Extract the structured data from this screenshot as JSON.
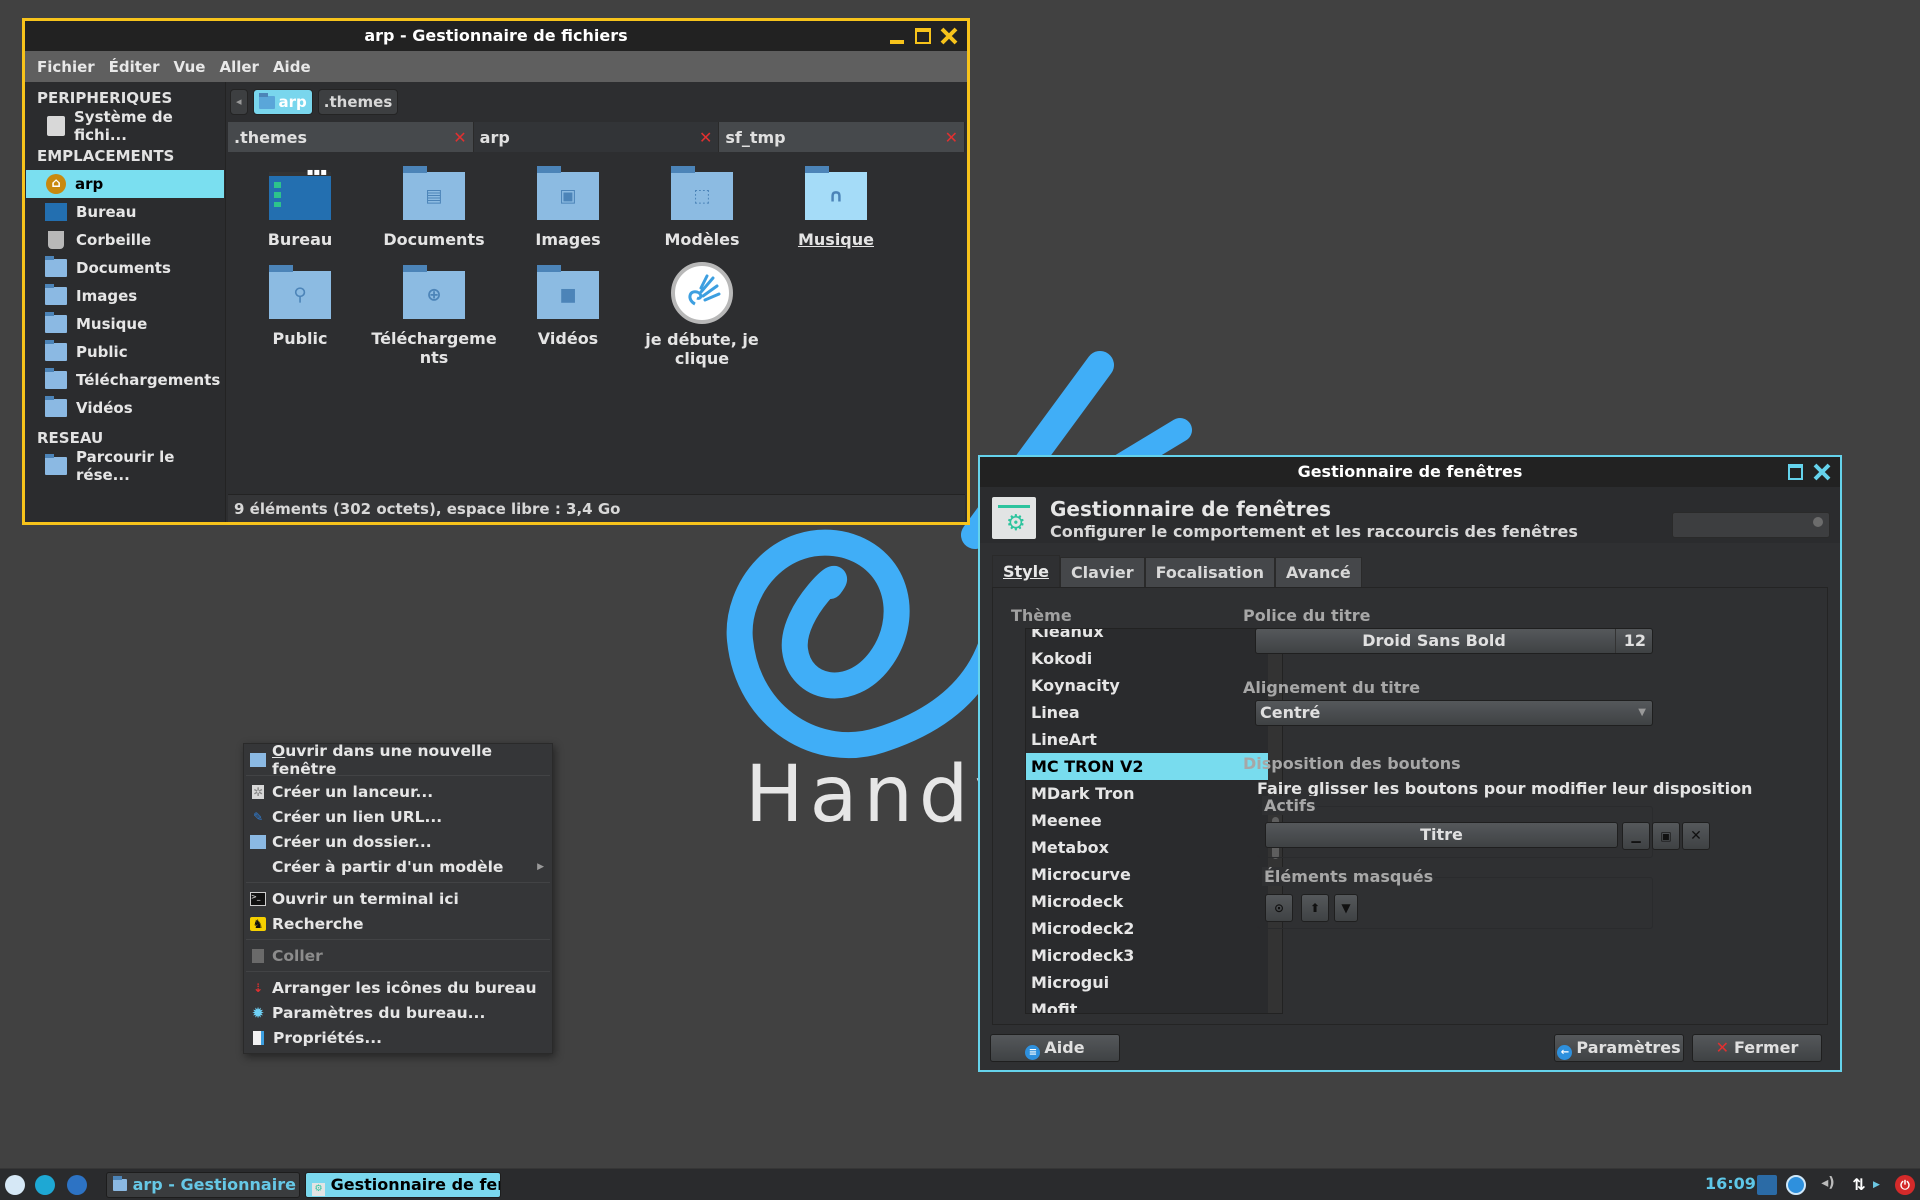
{
  "desktop": {
    "wallpaper_text": "Handy",
    "accent_color": "#40aef7"
  },
  "file_manager": {
    "title": "arp - Gestionnaire de fichiers",
    "border_color": "#f7c31b",
    "menu": [
      "Fichier",
      "Éditer",
      "Vue",
      "Aller",
      "Aide"
    ],
    "sidebar": {
      "sections": [
        {
          "heading": "PERIPHERIQUES",
          "items": [
            {
              "label": "Système de fichi...",
              "icon": "drive-icon"
            }
          ]
        },
        {
          "heading": "EMPLACEMENTS",
          "items": [
            {
              "label": "arp",
              "icon": "home-icon",
              "active": true
            },
            {
              "label": "Bureau",
              "icon": "desktop-folder-icon"
            },
            {
              "label": "Corbeille",
              "icon": "trash-icon"
            },
            {
              "label": "Documents",
              "icon": "documents-folder-icon"
            },
            {
              "label": "Images",
              "icon": "images-folder-icon"
            },
            {
              "label": "Musique",
              "icon": "music-folder-icon"
            },
            {
              "label": "Public",
              "icon": "public-folder-icon"
            },
            {
              "label": "Téléchargements",
              "icon": "downloads-folder-icon"
            },
            {
              "label": "Vidéos",
              "icon": "videos-folder-icon"
            }
          ]
        },
        {
          "heading": "RESEAU",
          "items": [
            {
              "label": "Parcourir le rése...",
              "icon": "network-folder-icon"
            }
          ]
        }
      ]
    },
    "pathbar": {
      "back": "◂",
      "crumbs": [
        "arp",
        ".themes"
      ],
      "active_crumb": "arp"
    },
    "tabs": [
      {
        "label": ".themes",
        "active": false
      },
      {
        "label": "arp",
        "active": true
      },
      {
        "label": "sf_tmp",
        "active": false
      }
    ],
    "tab_close_glyph": "✕",
    "items": [
      {
        "label": "Bureau",
        "icon": "desktop-folder-icon"
      },
      {
        "label": "Documents",
        "icon": "documents-folder-icon"
      },
      {
        "label": "Images",
        "icon": "images-folder-icon"
      },
      {
        "label": "Modèles",
        "icon": "templates-folder-icon"
      },
      {
        "label": "Musique",
        "icon": "music-folder-icon",
        "hovered": true
      },
      {
        "label": "Public",
        "icon": "public-folder-icon"
      },
      {
        "label": "Téléchargements",
        "icon": "downloads-folder-icon"
      },
      {
        "label": "Vidéos",
        "icon": "videos-folder-icon"
      },
      {
        "label": "je débute, je clique",
        "icon": "handy-launcher-icon"
      }
    ],
    "status": "9 éléments (302 octets), espace libre : 3,4 Go"
  },
  "context_menu": {
    "items": [
      {
        "label": "Ouvrir dans une nouvelle fenêtre",
        "icon": "folder-icon"
      },
      {
        "separator": true
      },
      {
        "label": "Créer un lanceur...",
        "icon": "launcher-icon"
      },
      {
        "label": "Créer un lien URL...",
        "icon": "url-link-icon"
      },
      {
        "label": "Créer un dossier...",
        "icon": "folder-icon"
      },
      {
        "label": "Créer à partir d'un modèle",
        "icon": "",
        "submenu": true
      },
      {
        "separator": true
      },
      {
        "label": "Ouvrir un terminal ici",
        "icon": "terminal-icon"
      },
      {
        "label": "Recherche",
        "icon": "search-catfish-icon"
      },
      {
        "separator": true
      },
      {
        "label": "Coller",
        "icon": "paste-icon",
        "disabled": true
      },
      {
        "separator": true
      },
      {
        "label": "Arranger les icônes du bureau",
        "icon": "arrange-icon"
      },
      {
        "label": "Paramètres du bureau...",
        "icon": "desktop-settings-icon"
      },
      {
        "label": "Propriétés...",
        "icon": "properties-icon"
      }
    ]
  },
  "wm_dialog": {
    "title": "Gestionnaire de fenêtres",
    "border_color": "#65d3ec",
    "header_title": "Gestionnaire de fenêtres",
    "header_subtitle": "Configurer le comportement et les raccourcis des fenêtres",
    "search_placeholder": "",
    "tabs": [
      {
        "label": "Style",
        "active": true
      },
      {
        "label": "Clavier",
        "active": false
      },
      {
        "label": "Focalisation",
        "active": false
      },
      {
        "label": "Avancé",
        "active": false
      }
    ],
    "theme_label": "Thème",
    "themes": [
      "Kleanux",
      "Kokodi",
      "Koynacity",
      "Linea",
      "LineArt",
      "MC TRON V2",
      "MDark Tron",
      "Meenee",
      "Metabox",
      "Microcurve",
      "Microdeck",
      "Microdeck2",
      "Microdeck3",
      "Microgui",
      "Mofit"
    ],
    "selected_theme": "MC TRON V2",
    "title_font_label": "Police du titre",
    "title_font_name": "Droid Sans Bold",
    "title_font_size": "12",
    "title_align_label": "Alignement du titre",
    "title_align_value": "Centré",
    "button_layout_label": "Disposition des boutons",
    "button_layout_hint": "Faire glisser les boutons pour modifier leur disposition",
    "active_label": "Actifs",
    "active_title_button": "Titre",
    "hidden_label": "Éléments masqués",
    "footer": {
      "help": "Aide",
      "settings": "Paramètres",
      "close": "Fermer"
    }
  },
  "taskbar": {
    "launchers": [
      "handy-menu-icon",
      "xfce-mouse-icon",
      "gimp-icon"
    ],
    "tasks": [
      {
        "label": "arp - Gestionnaire d...",
        "active": false
      },
      {
        "label": "Gestionnaire de fen...",
        "active": true
      }
    ],
    "clock": "16:09",
    "tray": [
      "update-icon",
      "accessibility-icon",
      "volume-icon",
      "network-icon",
      "expand-arrow-icon",
      "power-icon"
    ]
  }
}
